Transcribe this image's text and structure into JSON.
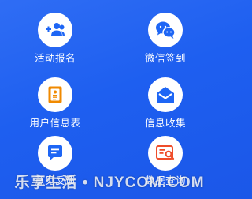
{
  "menu": {
    "items": [
      {
        "label": "活动报名",
        "icon": "group-add-icon",
        "color": "#1e66f5"
      },
      {
        "label": "微信签到",
        "icon": "wechat-icon",
        "color": "#1e66f5"
      },
      {
        "label": "用户信息表",
        "icon": "document-icon",
        "color": "#f08a00"
      },
      {
        "label": "信息收集",
        "icon": "envelope-icon",
        "color": "#1e66f5"
      },
      {
        "label": "意见反馈",
        "icon": "chat-bubble-icon",
        "color": "#1e66f5"
      },
      {
        "label": "数据查询",
        "icon": "search-card-icon",
        "color": "#ef4d2a"
      }
    ]
  },
  "watermark": {
    "text": "乐享生活 • NJYCOM.COM"
  },
  "colors": {
    "background": "#2060f0",
    "tile_circle": "#ffffff",
    "label": "#ffffff"
  }
}
